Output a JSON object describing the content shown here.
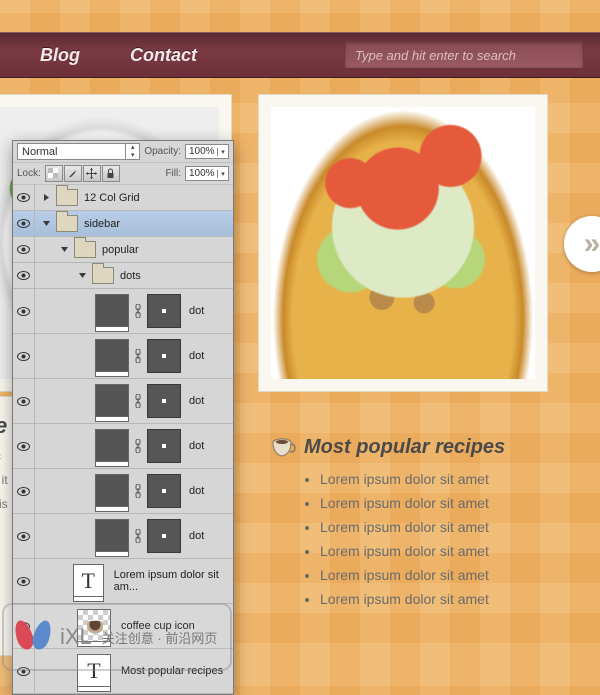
{
  "nav": {
    "links": [
      "Blog",
      "Contact"
    ],
    "search_placeholder": "Type and hit enter to search"
  },
  "popular": {
    "title": "Most popular recipes",
    "items": [
      "Lorem ipsum dolor sit amet",
      "Lorem ipsum dolor sit amet",
      "Lorem ipsum dolor sit amet",
      "Lorem ipsum dolor sit amet",
      "Lorem ipsum dolor sit amet",
      "Lorem ipsum dolor sit amet"
    ]
  },
  "left_tail": {
    "heading_fragment": "e",
    "p1": "c",
    "p2": "t it",
    "p3": "ris"
  },
  "ps": {
    "blend_mode": "Normal",
    "opacity_label": "Opacity:",
    "opacity_value": "100%",
    "lock_label": "Lock:",
    "fill_label": "Fill:",
    "fill_value": "100%",
    "layers": [
      {
        "type": "group",
        "name": "12 Col Grid",
        "depth": 0,
        "expanded": false,
        "eye": true,
        "selected": false
      },
      {
        "type": "group",
        "name": "sidebar",
        "depth": 0,
        "expanded": true,
        "eye": true,
        "selected": true
      },
      {
        "type": "group",
        "name": "popular",
        "depth": 1,
        "expanded": true,
        "eye": true,
        "selected": false
      },
      {
        "type": "group",
        "name": "dots",
        "depth": 2,
        "expanded": true,
        "eye": true,
        "selected": false
      },
      {
        "type": "mask",
        "name": "dot",
        "depth": 3,
        "eye": true
      },
      {
        "type": "mask",
        "name": "dot",
        "depth": 3,
        "eye": true
      },
      {
        "type": "mask",
        "name": "dot",
        "depth": 3,
        "eye": true
      },
      {
        "type": "mask",
        "name": "dot",
        "depth": 3,
        "eye": true
      },
      {
        "type": "mask",
        "name": "dot",
        "depth": 3,
        "eye": true
      },
      {
        "type": "mask",
        "name": "dot",
        "depth": 3,
        "eye": true
      },
      {
        "type": "text",
        "name": "Lorem ipsum dolor sit am...",
        "depth": 2,
        "eye": true
      },
      {
        "type": "image",
        "name": "coffee cup icon",
        "depth": 2,
        "eye": true
      },
      {
        "type": "text",
        "name": "Most popular recipes",
        "depth": 2,
        "eye": true
      }
    ]
  },
  "watermark": {
    "big": "iXL",
    "small": "关注创意 · 前沿网页"
  }
}
